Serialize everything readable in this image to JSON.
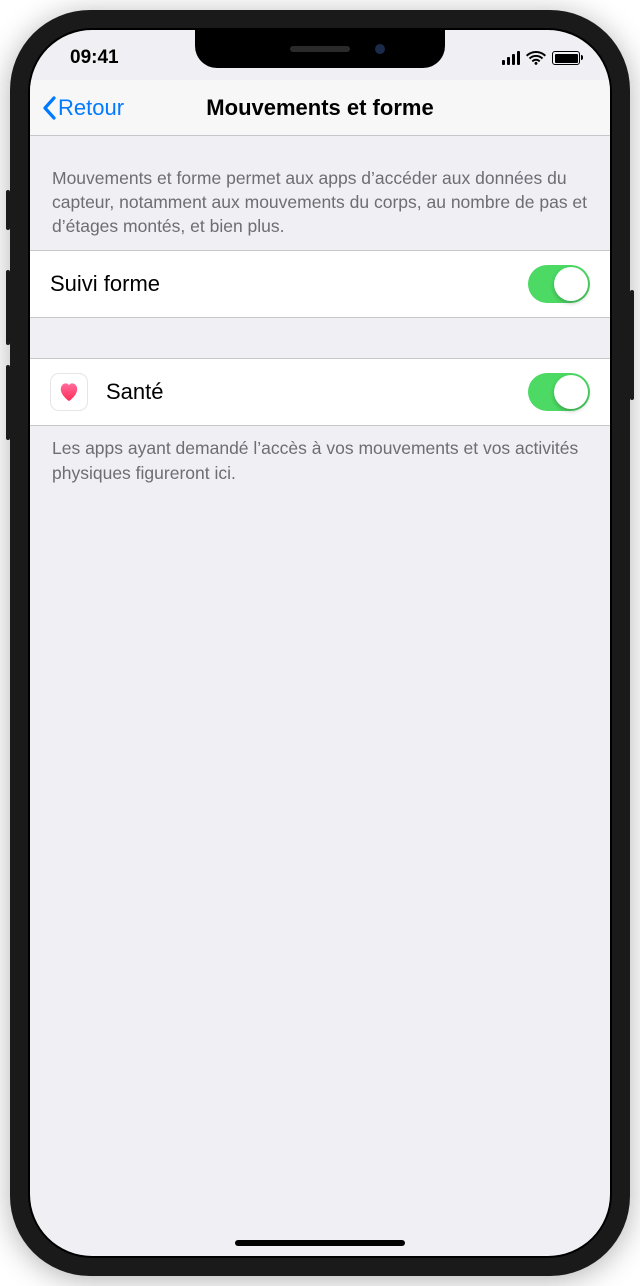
{
  "status": {
    "time": "09:41"
  },
  "nav": {
    "back": "Retour",
    "title": "Mouvements et forme"
  },
  "header_text": "Mouvements et forme permet aux apps d’accéder aux données du capteur, notamment aux mouvements du corps, au nombre de pas et d’étages montés, et bien plus.",
  "rows": {
    "fitness_tracking": {
      "label": "Suivi forme",
      "on": true
    },
    "health_app": {
      "label": "Santé",
      "on": true
    }
  },
  "footer_text": "Les apps ayant demandé l’accès à vos mouvements et vos activités physiques figureront ici."
}
